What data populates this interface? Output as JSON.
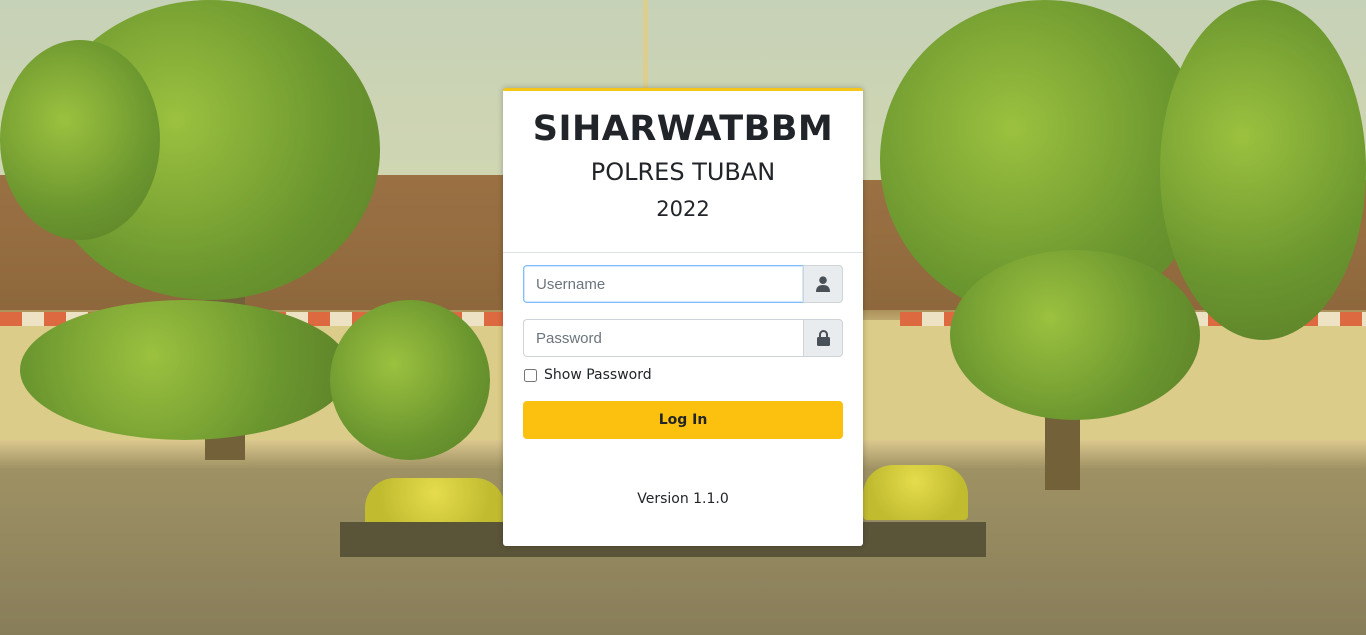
{
  "header": {
    "title": "SIHARWATBBM",
    "subtitle": "POLRES TUBAN",
    "year": "2022"
  },
  "form": {
    "username": {
      "value": "",
      "placeholder": "Username",
      "icon": "user-icon"
    },
    "password": {
      "value": "",
      "placeholder": "Password",
      "icon": "lock-icon"
    },
    "show_password_label": "Show Password",
    "show_password_checked": false,
    "login_label": "Log In"
  },
  "footer": {
    "version": "Version 1.1.0"
  },
  "colors": {
    "accent": "#fcc00f",
    "card_border_top": "#f5c518",
    "addon_bg": "#e9ecef"
  }
}
